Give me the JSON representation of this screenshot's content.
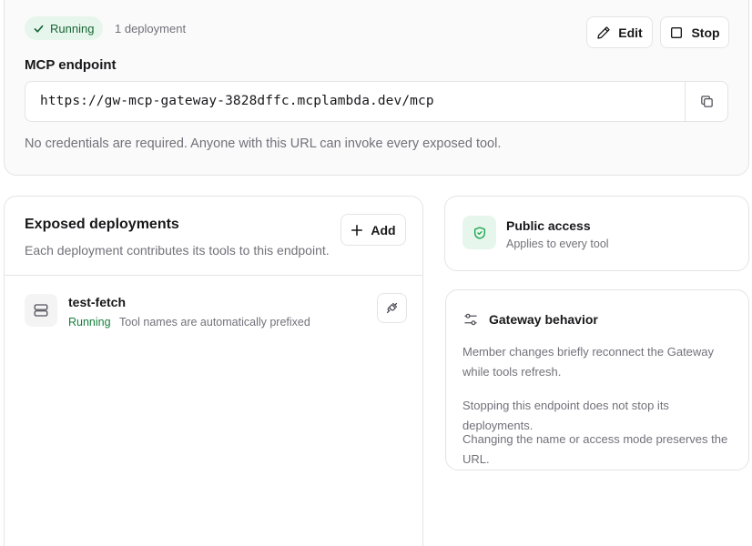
{
  "status": {
    "label": "Running",
    "deployments_count": "1 deployment"
  },
  "actions": {
    "edit_label": "Edit",
    "stop_label": "Stop"
  },
  "endpoint": {
    "title": "MCP endpoint",
    "url": "https://gw-mcp-gateway-3828dffc.mcplambda.dev/mcp",
    "note": "No credentials are required. Anyone with this URL can invoke every exposed tool."
  },
  "deployments": {
    "title": "Exposed deployments",
    "subtitle": "Each deployment contributes its tools to this endpoint.",
    "add_label": "Add",
    "items": [
      {
        "name": "test-fetch",
        "status": "Running",
        "note": "Tool names are automatically prefixed"
      }
    ]
  },
  "access": {
    "title": "Public access",
    "subtitle": "Applies to every tool"
  },
  "behavior": {
    "title": "Gateway behavior",
    "notes": [
      "Member changes briefly reconnect the Gateway while tools refresh.",
      "Stopping this endpoint does not stop its deployments.",
      "Changing the name or access mode preserves the URL."
    ]
  },
  "colors": {
    "success_bg": "#e7f6ec",
    "success_text": "#166534",
    "border": "#e4e4e7",
    "muted_text": "#71717a"
  },
  "icons": {
    "status": "check-icon",
    "edit": "pencil-icon",
    "stop": "square-icon",
    "copy": "copy-icon",
    "add": "plus-icon",
    "deployment": "server-icon",
    "detach": "unplug-icon",
    "access": "shield-check-icon",
    "behavior": "sliders-icon"
  }
}
